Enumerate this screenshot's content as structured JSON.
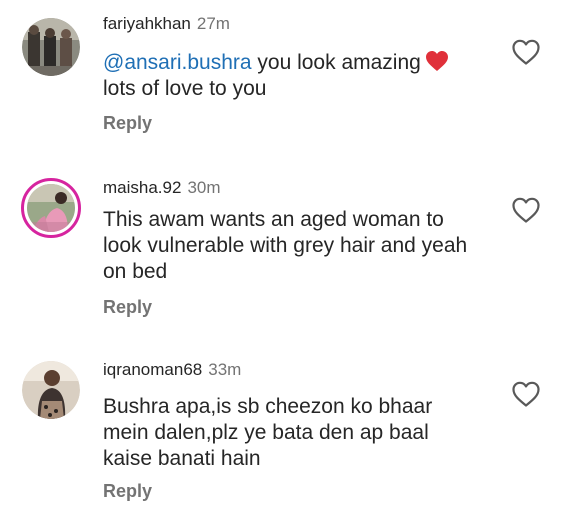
{
  "comments": [
    {
      "username": "fariyahkhan",
      "time": "27m",
      "mention": "@ansari.bushra",
      "text_after_mention": " you look amazing",
      "text_line2": "lots of love to you",
      "reply_label": "Reply",
      "avatar_icon": "user-photo-avatar",
      "like_icon": "heart-outline-icon"
    },
    {
      "username": "maisha.92",
      "time": "30m",
      "text": "This awam wants an aged woman to look vulnerable with grey hair and yeah on bed",
      "reply_label": "Reply",
      "avatar_icon": "user-photo-avatar-story-ring",
      "like_icon": "heart-outline-icon"
    },
    {
      "username": "iqranoman68",
      "time": "33m",
      "text": "Bushra apa,is sb cheezon ko bhaar mein dalen,plz ye bata den ap baal kaise banati hain",
      "reply_label": "Reply",
      "avatar_icon": "user-photo-avatar",
      "like_icon": "heart-outline-icon"
    }
  ],
  "colors": {
    "primary_text": "#262626",
    "secondary_text": "#737373",
    "mention": "#1f6fb5",
    "heart_emoji": "#e0303a",
    "story_ring": "#d6249f"
  }
}
